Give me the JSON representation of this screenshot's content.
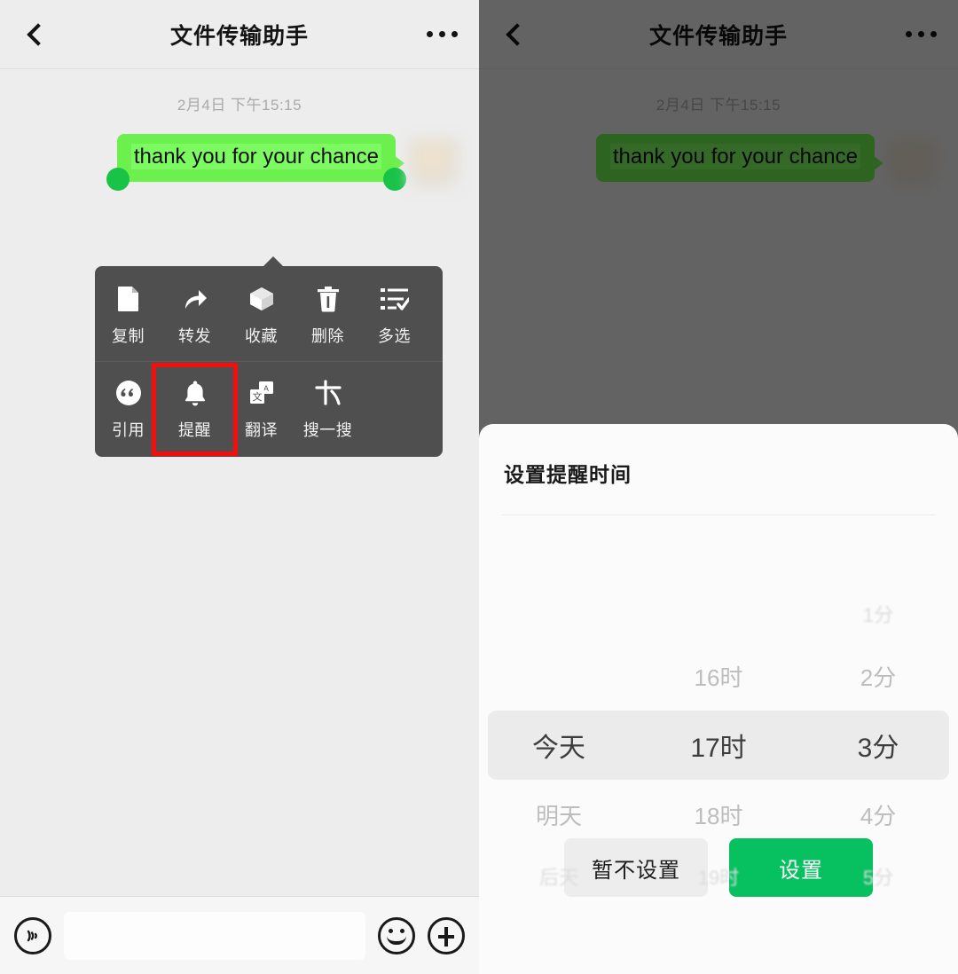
{
  "app": {
    "header": {
      "title": "文件传输助手",
      "back_icon": "chevron-left-icon",
      "more_icon": "more-horizontal-icon"
    },
    "chat": {
      "timestamp": "2月4日 下午15:15",
      "message": {
        "text": "thank you for your chance",
        "direction": "outgoing",
        "bubble_color": "#6cf04e",
        "selection_color": "#7dfa61",
        "handle_color": "#18c348"
      }
    },
    "input_bar": {
      "voice_icon": "voice-wave-icon",
      "input_placeholder": "",
      "input_value": "",
      "emoji_icon": "smiley-icon",
      "plus_icon": "plus-icon"
    }
  },
  "context_menu": {
    "background": "#4f4f4f",
    "highlight_color": "#f60d0d",
    "highlighted_item": "提醒",
    "row1": [
      {
        "label": "复制",
        "icon": "document-copy-icon"
      },
      {
        "label": "转发",
        "icon": "forward-arrow-icon"
      },
      {
        "label": "收藏",
        "icon": "box-favorite-icon"
      },
      {
        "label": "删除",
        "icon": "trash-icon"
      },
      {
        "label": "多选",
        "icon": "multi-select-list-icon"
      }
    ],
    "row2": [
      {
        "label": "引用",
        "icon": "quote-icon"
      },
      {
        "label": "提醒",
        "icon": "bell-icon"
      },
      {
        "label": "翻译",
        "icon": "translate-icon"
      },
      {
        "label": "搜一搜",
        "icon": "wechat-search-icon"
      }
    ]
  },
  "sheet": {
    "title": "设置提醒时间",
    "picker": {
      "day_column": {
        "values": [
          "今天",
          "明天",
          "后天"
        ],
        "selected": "今天",
        "selected_index": 0
      },
      "hour_column": {
        "values": [
          "16时",
          "17时",
          "18时",
          "19时"
        ],
        "selected": "17时",
        "selected_index": 1
      },
      "minute_column": {
        "values": [
          "1分",
          "2分",
          "3分",
          "4分",
          "5分"
        ],
        "selected": "3分",
        "selected_index": 2
      },
      "selected_summary": "今天 17时 3分",
      "band_color": "#ebebeb"
    },
    "actions": {
      "cancel_label": "暂不设置",
      "confirm_label": "设置",
      "confirm_color": "#07c160",
      "cancel_color": "#ededed"
    }
  }
}
